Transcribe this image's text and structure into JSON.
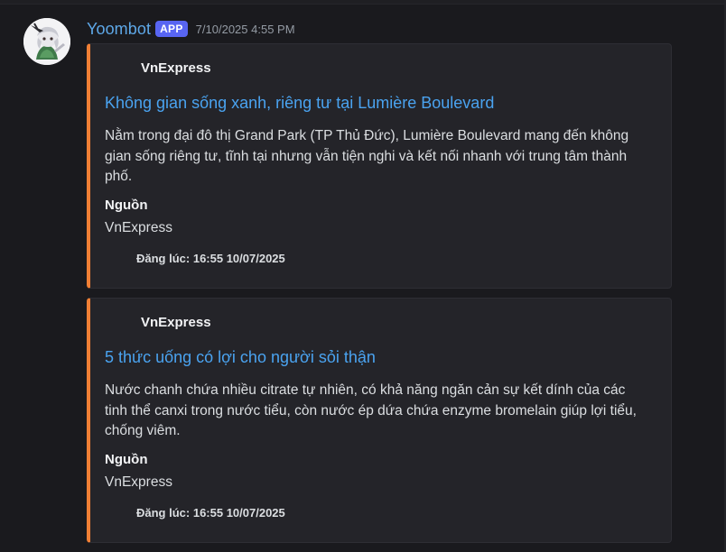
{
  "message": {
    "username": "Yoombot",
    "badge": "APP",
    "timestamp": "7/10/2025 4:55 PM",
    "avatar_icon": "bot-avatar-icon"
  },
  "embeds": [
    {
      "author": "VnExpress",
      "title": "Không gian sống xanh, riêng tư tại Lumière Boulevard",
      "description": "Nằm trong đại đô thị Grand Park (TP Thủ Đức), Lumière Boulevard mang đến không gian sống riêng tư, tĩnh tại nhưng vẫn tiện nghi và kết nối nhanh với trung tâm thành phố.",
      "field_name": "Nguồn",
      "field_value": "VnExpress",
      "footer": "Đăng lúc: 16:55 10/07/2025",
      "accent_color": "#f07f35"
    },
    {
      "author": "VnExpress",
      "title": "5 thức uống có lợi cho người sỏi thận",
      "description": "Nước chanh chứa nhiều citrate tự nhiên, có khả năng ngăn cản sự kết dính của các tinh thể canxi trong nước tiểu, còn nước ép dứa chứa enzyme bromelain giúp lợi tiểu, chống viêm.",
      "field_name": "Nguồn",
      "field_value": "VnExpress",
      "footer": "Đăng lúc: 16:55 10/07/2025",
      "accent_color": "#f07f35"
    }
  ]
}
